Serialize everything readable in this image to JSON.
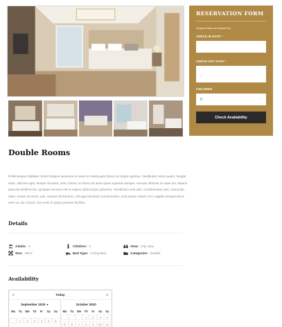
{
  "gallery": {
    "main_image": "hotel-bedroom-photo",
    "thumbnails": [
      "bedroom-thumb-1",
      "bedroom-thumb-2",
      "bedroom-thumb-3",
      "bedroom-thumb-4",
      "bedroom-thumb-5"
    ]
  },
  "reservation": {
    "title": "RESERVATION FORM",
    "note": "Required fields are followed by *",
    "checkin_label": "CHECK-IN DATE *",
    "checkin_value": "",
    "checkout_label": "CHECK-OUT DATE *",
    "checkout_value": "-",
    "children_label": "CHILDREN",
    "children_value": "0",
    "button_label": "Check Availability",
    "accent_color": "#b08a45"
  },
  "room": {
    "title": "Double Rooms",
    "description": "Pellentesque habitant morbi tristique senectus et netus et malesuada fames ac turpis egestas. Vestibulum tortor quam, feugiat vitae, ultricies eget, tempor sit amet, ante. Donec eu libero sit amet quam egestas semper. Aenean ultricies mi vitae est. Mauris placerat eleifend leo. Quisque sit amet est et sapien ullamcorper pharetra. Vestibulum erat wisi, condimentum sed, commodo vitae, ornare sit amet, wisi. Aenean fermentum, elit eget tincidunt condimentum, eros ipsum rutrum orci, sagittis tempus lacus enim ac dui. Donec non enim in turpis pulvinar facilisis."
  },
  "details": {
    "title": "Details",
    "adults_label": "Adults:",
    "adults_value": "4",
    "children_label": "Children:",
    "children_value": "2",
    "view_label": "View:",
    "view_value": "City view",
    "size_label": "Size:",
    "size_value": "60m²",
    "bed_label": "Bed Type:",
    "bed_value": "2 King Bed",
    "categories_label": "Categories:",
    "categories_value": "Double"
  },
  "availability": {
    "title": "Availability",
    "today_label": "Today",
    "prev": "«",
    "next": "»",
    "months": [
      "September 2020",
      "October 2020"
    ],
    "weekdays": [
      "Mo",
      "Tu",
      "We",
      "Th",
      "Fr",
      "Sa",
      "Su"
    ],
    "sept_days": [
      "",
      "1",
      "2",
      "3",
      "4",
      "5",
      "6"
    ],
    "oct_days": [
      "",
      "",
      "",
      "1",
      "2",
      "3",
      "4",
      "5",
      "6",
      "7",
      "8",
      "9",
      "10",
      "11"
    ]
  }
}
